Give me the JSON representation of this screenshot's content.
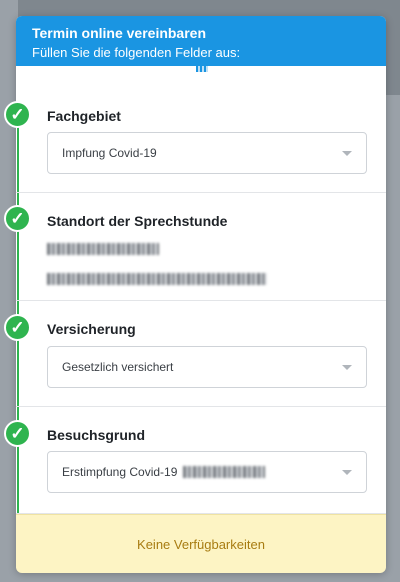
{
  "header": {
    "title": "Termin online vereinbaren",
    "subtitle": "Füllen Sie die folgenden Felder aus:"
  },
  "sections": [
    {
      "label": "Fachgebiet",
      "select_value": "Impfung Covid-19",
      "icon": "check-icon"
    },
    {
      "label": "Standort der Sprechstunde",
      "icon": "check-icon"
    },
    {
      "label": "Versicherung",
      "select_value": "Gesetzlich versichert",
      "icon": "check-icon"
    },
    {
      "label": "Besuchsgrund",
      "select_value": "Erstimpfung Covid-19",
      "icon": "check-icon"
    }
  ],
  "footer": {
    "text": "Keine Verfügbarkeiten"
  },
  "colors": {
    "header_bg": "#1a95e2",
    "check_green": "#2fb44f",
    "footer_bg": "#fdf4c4",
    "footer_text": "#a87c12"
  }
}
